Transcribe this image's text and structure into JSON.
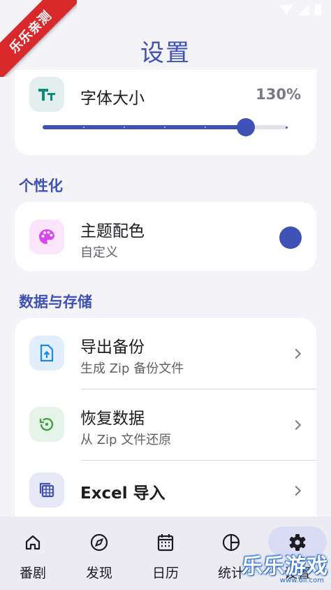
{
  "watermark_ribbon": "乐乐亲测",
  "title": "设置",
  "font_size": {
    "label": "字体大小",
    "value": "130%",
    "slider_level": 0.83
  },
  "sections": {
    "personalize": "个性化",
    "data_storage": "数据与存储"
  },
  "theme": {
    "title": "主题配色",
    "subtitle": "自定义",
    "color": "#3f51b5"
  },
  "data_items": [
    {
      "title": "导出备份",
      "subtitle": "生成 Zip 备份文件",
      "icon": "export-file-icon"
    },
    {
      "title": "恢复数据",
      "subtitle": "从 Zip 文件还原",
      "icon": "restore-icon"
    },
    {
      "title": "Excel 导入",
      "subtitle": "",
      "icon": "excel-grid-icon"
    }
  ],
  "nav": [
    {
      "label": "番剧",
      "icon": "home-icon",
      "active": false
    },
    {
      "label": "发现",
      "icon": "compass-icon",
      "active": false
    },
    {
      "label": "日历",
      "icon": "calendar-icon",
      "active": false
    },
    {
      "label": "统计",
      "icon": "pie-chart-icon",
      "active": false
    },
    {
      "label": "设置",
      "icon": "gear-icon",
      "active": true
    }
  ],
  "watermark": {
    "brand": "乐乐游戏",
    "url": "www.6ll.com"
  },
  "colors": {
    "accent": "#3f51b5",
    "background": "#f4f3f8"
  }
}
